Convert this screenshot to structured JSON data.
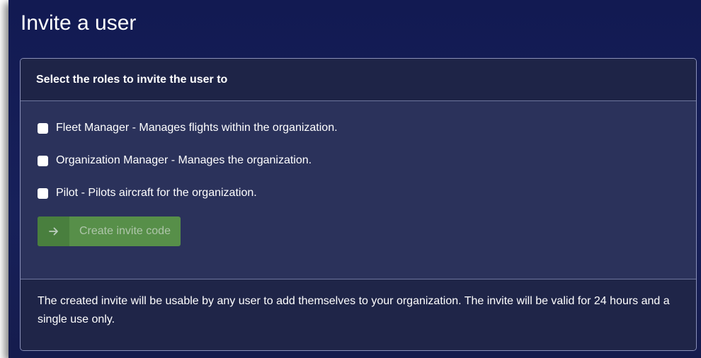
{
  "page": {
    "title": "Invite a user"
  },
  "card": {
    "header": "Select the roles to invite the user to",
    "roles": [
      {
        "label": "Fleet Manager - Manages flights within the organization.",
        "checked": false
      },
      {
        "label": "Organization Manager - Manages the organization.",
        "checked": false
      },
      {
        "label": "Pilot - Pilots aircraft for the organization.",
        "checked": false
      }
    ],
    "button": {
      "label": "Create invite code",
      "icon": "arrow-right-icon",
      "enabled": false
    },
    "footer_text": "The created invite will be usable by any user to add themselves to your organization. The invite will be valid for 24 hours and a single use only."
  },
  "colors": {
    "background": "#17205a",
    "card": "#2a3159",
    "button": "#5fa046"
  }
}
